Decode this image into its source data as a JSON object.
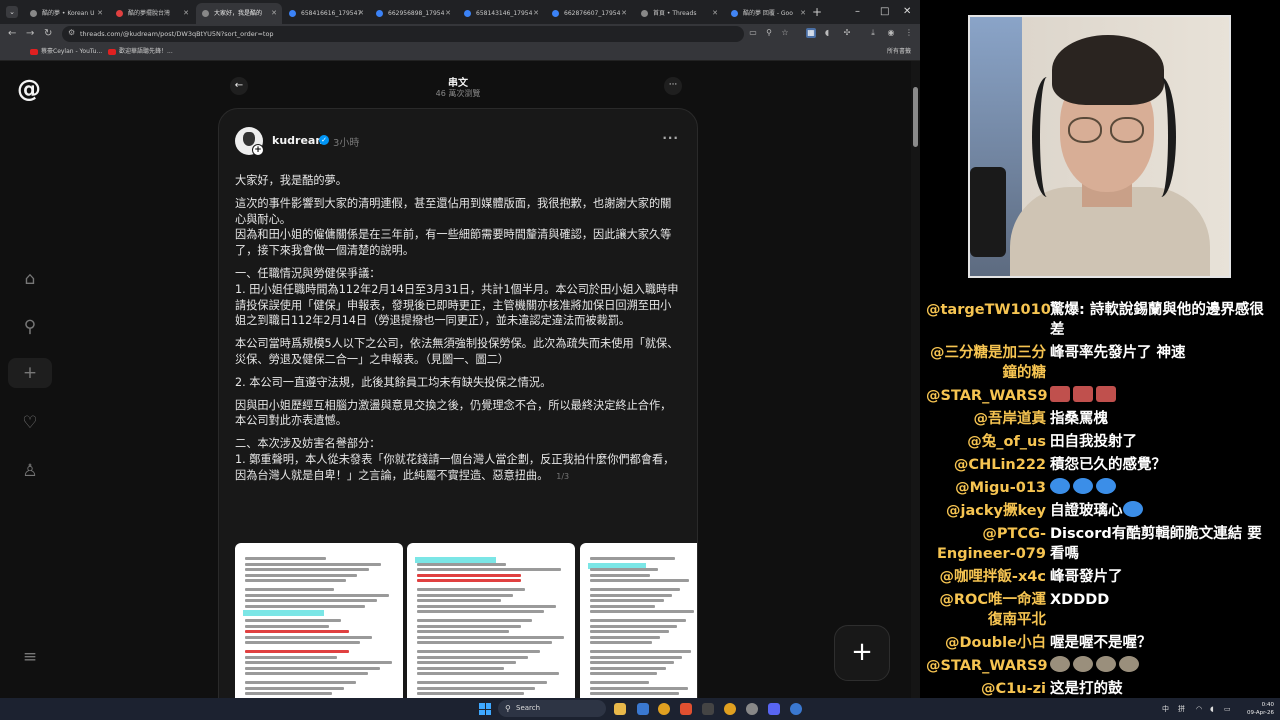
{
  "tabs": [
    {
      "title": "酷的夢 • Korean U",
      "color": "#888"
    },
    {
      "title": "酷的夢擺脫台灣",
      "color": "#e04040"
    },
    {
      "title": "大家好，我是酷的",
      "color": "#888"
    },
    {
      "title": "658416616_179547",
      "color": "#3b82f6"
    },
    {
      "title": "662956898_17954",
      "color": "#3b82f6"
    },
    {
      "title": "658143146_17954",
      "color": "#3b82f6"
    },
    {
      "title": "662876607_17954",
      "color": "#3b82f6"
    },
    {
      "title": "首頁 • Threads",
      "color": "#888"
    },
    {
      "title": "酷的夢 回覆 - Goo",
      "color": "#4285f4"
    }
  ],
  "window": {
    "minimize": "–",
    "maximize": "□",
    "close": "✕",
    "new_tab": "+"
  },
  "address": {
    "url": "threads.com/@kudream/post/DW3qBtYU5N?sort_order=top"
  },
  "bookmarks": [
    {
      "label": "蔡豪Ceylan - YouTu..."
    },
    {
      "label": "歡迎華語聽先鋒！..."
    }
  ],
  "bookmarks_all": "所有書籤",
  "thread": {
    "title": "串文",
    "views": "46 萬次瀏覽",
    "author": "kudream",
    "time": "3小時",
    "pager": "1/3",
    "paragraphs": [
      "大家好，我是酷的夢。",
      "這次的事件影響到大家的清明連假，甚至還佔用到媒體版面，我很抱歉，也謝謝大家的關心與耐心。",
      "因為和田小姐的僱傭關係是在三年前，有一些細節需要時間釐清與確認，因此讓大家久等了，接下來我會做一個清楚的說明。",
      "一、任職情況與勞健保爭議：",
      "1. 田小姐任職時間為112年2月14日至3月31日，共計1個半月。本公司於田小姐入職時申請投保誤使用「健保」申報表，發現後已即時更正，主管機關亦核准將加保日回溯至田小姐之到職日112年2月14日（勞退提撥也一同更正），並未違認定違法而被裁罰。",
      "本公司當時爲規模5人以下之公司，依法無須強制投保勞保。此次為疏失而未使用「就保、災保、勞退及健保二合一」之申報表。（見圖一、圖二）",
      "2. 本公司一直遵守法規，此後其餘員工均未有缺失投保之情況。",
      "因與田小姐歷經互相腦力激盪與意見交換之後，仍覺理念不合，所以最終決定終止合作，本公司對此亦表遺憾。",
      "二、本次涉及妨害名譽部分：",
      "1. 鄭重聲明，本人從未發表「你就花錢請一個台灣人當企劃，反正我拍什麼你們都會看，因為台灣人就是自卑！」之言論，此純屬不實捏造、惡意扭曲。"
    ]
  },
  "taskbar": {
    "search_placeholder": "Search",
    "lang1": "中",
    "lang2": "拼",
    "time": "0:40",
    "date": "09-Apr-26"
  },
  "chat": [
    {
      "author": "@targeTW1010",
      "text": "驚爆: 詩軟說錫蘭與他的邊界感很差"
    },
    {
      "author": "@三分糖是加三分鐘的糖",
      "text": "峰哥率先發片了 神速"
    },
    {
      "author": "@STAR_WARS9",
      "text": "",
      "emotes": [
        "red",
        "red",
        "red"
      ]
    },
    {
      "author": "@吾岸道真",
      "text": "指桑罵槐"
    },
    {
      "author": "@兔_of_us",
      "text": "田自我投射了"
    },
    {
      "author": "@CHLin222",
      "text": "積怨已久的感覺？"
    },
    {
      "author": "@Migu-013",
      "text": "",
      "emotes": [
        "blue",
        "blue",
        "blue"
      ]
    },
    {
      "author": "@jacky撅key",
      "text": "自證玻璃心",
      "emotes_after": [
        "blue"
      ]
    },
    {
      "author": "@PTCG-Engineer-079",
      "text": "Discord有酷剪輯師脆文連結 要看嗎"
    },
    {
      "author": "@咖哩拌飯-x4c",
      "text": "峰哥發片了"
    },
    {
      "author": "@ROC唯一命運復南平北",
      "text": "XDDDD"
    },
    {
      "author": "@Double小白",
      "text": "喔是喔不是喔？"
    },
    {
      "author": "@STAR_WARS9",
      "text": "",
      "emotes": [
        "gray",
        "gray",
        "gray",
        "gray"
      ]
    },
    {
      "author": "@C1u-zi",
      "text": "这是打的鼓"
    }
  ]
}
